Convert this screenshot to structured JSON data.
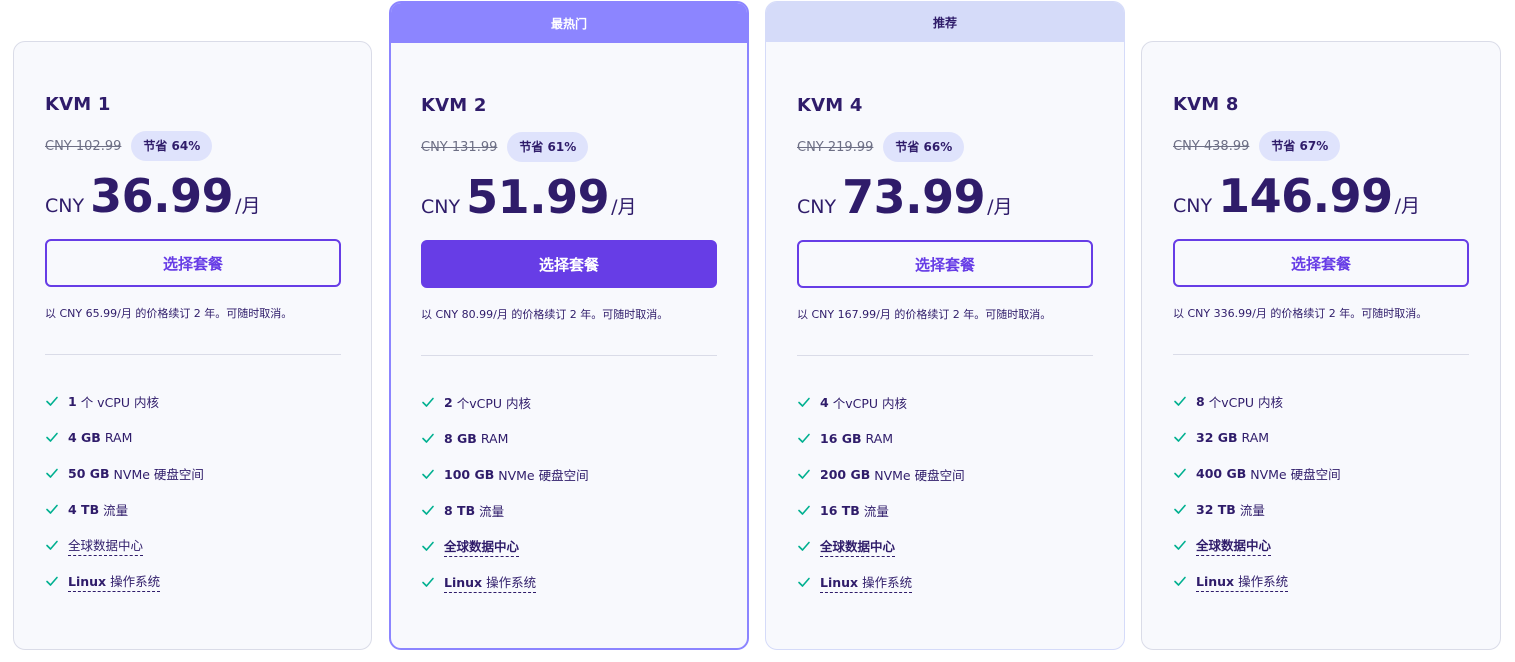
{
  "ribbons": {
    "hot": "最热门",
    "recommended": "推荐"
  },
  "colors": {
    "primary": "#673de6",
    "text": "#2f1c6a",
    "badge_bg": "#dfe3fc",
    "featured_border": "#8c85ff",
    "check": "#00b090"
  },
  "plans": [
    {
      "name": "KVM 1",
      "old_price": "CNY 102.99",
      "save": "节省 64%",
      "currency": "CNY",
      "price": "36.99",
      "per": "/月",
      "button": "选择套餐",
      "renew": "以 CNY 65.99/月 的价格续订 2 年。可随时取消。",
      "features": [
        {
          "strong": "1",
          "text": "个 vCPU 内核"
        },
        {
          "strong": "4 GB",
          "text": "RAM"
        },
        {
          "strong": "50 GB",
          "text": "NVMe 硬盘空间"
        },
        {
          "strong": "4 TB",
          "text": "流量"
        }
      ],
      "datacenter": "全球数据中心",
      "os_bold": "Linux",
      "os_text": " 操作系统"
    },
    {
      "name": "KVM 2",
      "old_price": "CNY 131.99",
      "save": "节省 61%",
      "currency": "CNY",
      "price": "51.99",
      "per": "/月",
      "button": "选择套餐",
      "renew": "以 CNY 80.99/月 的价格续订 2 年。可随时取消。",
      "features": [
        {
          "strong": "2",
          "text": "个vCPU 内核"
        },
        {
          "strong": "8 GB",
          "text": "RAM"
        },
        {
          "strong": "100 GB",
          "text": "NVMe 硬盘空间"
        },
        {
          "strong": "8 TB",
          "text": "流量"
        }
      ],
      "datacenter": "全球数据中心",
      "os_bold": "Linux",
      "os_text": " 操作系统"
    },
    {
      "name": "KVM 4",
      "old_price": "CNY 219.99",
      "save": "节省 66%",
      "currency": "CNY",
      "price": "73.99",
      "per": "/月",
      "button": "选择套餐",
      "renew": "以 CNY 167.99/月 的价格续订 2 年。可随时取消。",
      "features": [
        {
          "strong": "4",
          "text": "个vCPU 内核"
        },
        {
          "strong": "16 GB",
          "text": "RAM"
        },
        {
          "strong": "200 GB",
          "text": "NVMe 硬盘空间"
        },
        {
          "strong": "16 TB",
          "text": "流量"
        }
      ],
      "datacenter": "全球数据中心",
      "os_bold": "Linux",
      "os_text": " 操作系统"
    },
    {
      "name": "KVM 8",
      "old_price": "CNY 438.99",
      "save": "节省 67%",
      "currency": "CNY",
      "price": "146.99",
      "per": "/月",
      "button": "选择套餐",
      "renew": "以 CNY 336.99/月 的价格续订 2 年。可随时取消。",
      "features": [
        {
          "strong": "8",
          "text": "个vCPU 内核"
        },
        {
          "strong": "32 GB",
          "text": "RAM"
        },
        {
          "strong": "400 GB",
          "text": "NVMe 硬盘空间"
        },
        {
          "strong": "32 TB",
          "text": "流量"
        }
      ],
      "datacenter": "全球数据中心",
      "os_bold": "Linux",
      "os_text": " 操作系统"
    }
  ]
}
